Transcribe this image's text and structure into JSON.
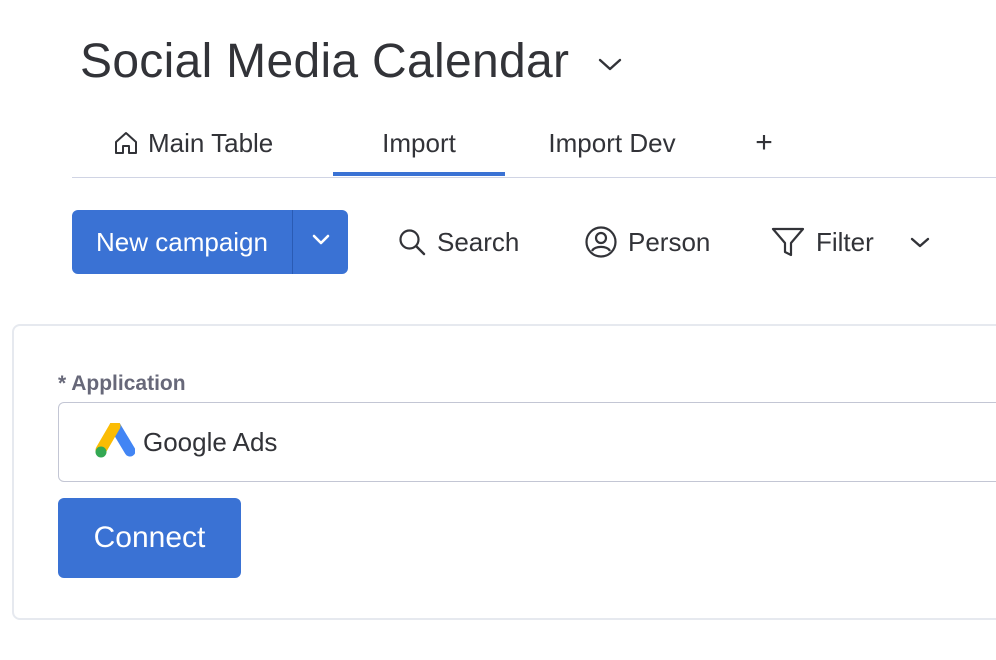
{
  "board": {
    "title": "Social Media Calendar",
    "title_chevron_icon": "chevron-down-icon"
  },
  "tabs": [
    {
      "label": "Main Table",
      "icon": "home-icon",
      "active": false
    },
    {
      "label": "Import",
      "active": true
    },
    {
      "label": "Import Dev",
      "active": false
    },
    {
      "label": "+",
      "icon": "add-icon",
      "active": false
    }
  ],
  "toolbar": {
    "new_label": "New campaign",
    "new_dropdown_icon": "chevron-down-icon",
    "search_label": "Search",
    "search_icon": "search-icon",
    "person_label": "Person",
    "person_icon": "person-icon",
    "filter_label": "Filter",
    "filter_icon": "filter-icon",
    "more_icon": "chevron-down-icon"
  },
  "form": {
    "application_label": "* Application",
    "application_value": "Google Ads",
    "application_logo": "google-ads-logo",
    "connect_label": "Connect"
  },
  "colors": {
    "primary": "#3a72d4",
    "text": "#323338",
    "label": "#676879",
    "border": "#c3c6d4"
  }
}
